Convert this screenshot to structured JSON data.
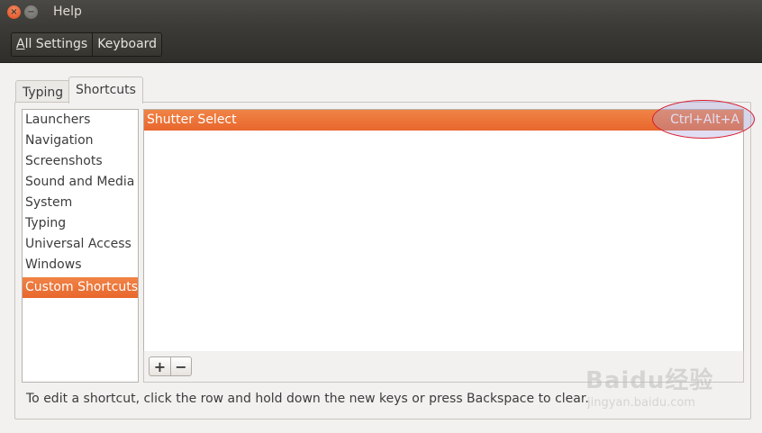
{
  "window": {
    "title": "Help"
  },
  "header": {
    "crumbs": [
      "All Settings",
      "Keyboard"
    ]
  },
  "tabs": [
    {
      "label": "Typing",
      "active": false
    },
    {
      "label": "Shortcuts",
      "active": true
    }
  ],
  "categories": [
    {
      "label": "Launchers",
      "selected": false
    },
    {
      "label": "Navigation",
      "selected": false
    },
    {
      "label": "Screenshots",
      "selected": false
    },
    {
      "label": "Sound and Media",
      "selected": false
    },
    {
      "label": "System",
      "selected": false
    },
    {
      "label": "Typing",
      "selected": false
    },
    {
      "label": "Universal Access",
      "selected": false
    },
    {
      "label": "Windows",
      "selected": false
    },
    {
      "label": "Custom Shortcuts",
      "selected": true
    }
  ],
  "shortcuts": [
    {
      "name": "Shutter Select",
      "accel": "Ctrl+Alt+A"
    }
  ],
  "toolbar": {
    "add_label": "+",
    "remove_label": "−"
  },
  "hint": "To edit a shortcut, click the row and hold down the new keys or press Backspace to clear.",
  "watermark": {
    "logo": "Baidu经验",
    "url": "jingyan.baidu.com"
  },
  "colors": {
    "accent": "#e9692f",
    "titlebar": "#3c3b37",
    "highlight_ring": "#d81c2c"
  }
}
